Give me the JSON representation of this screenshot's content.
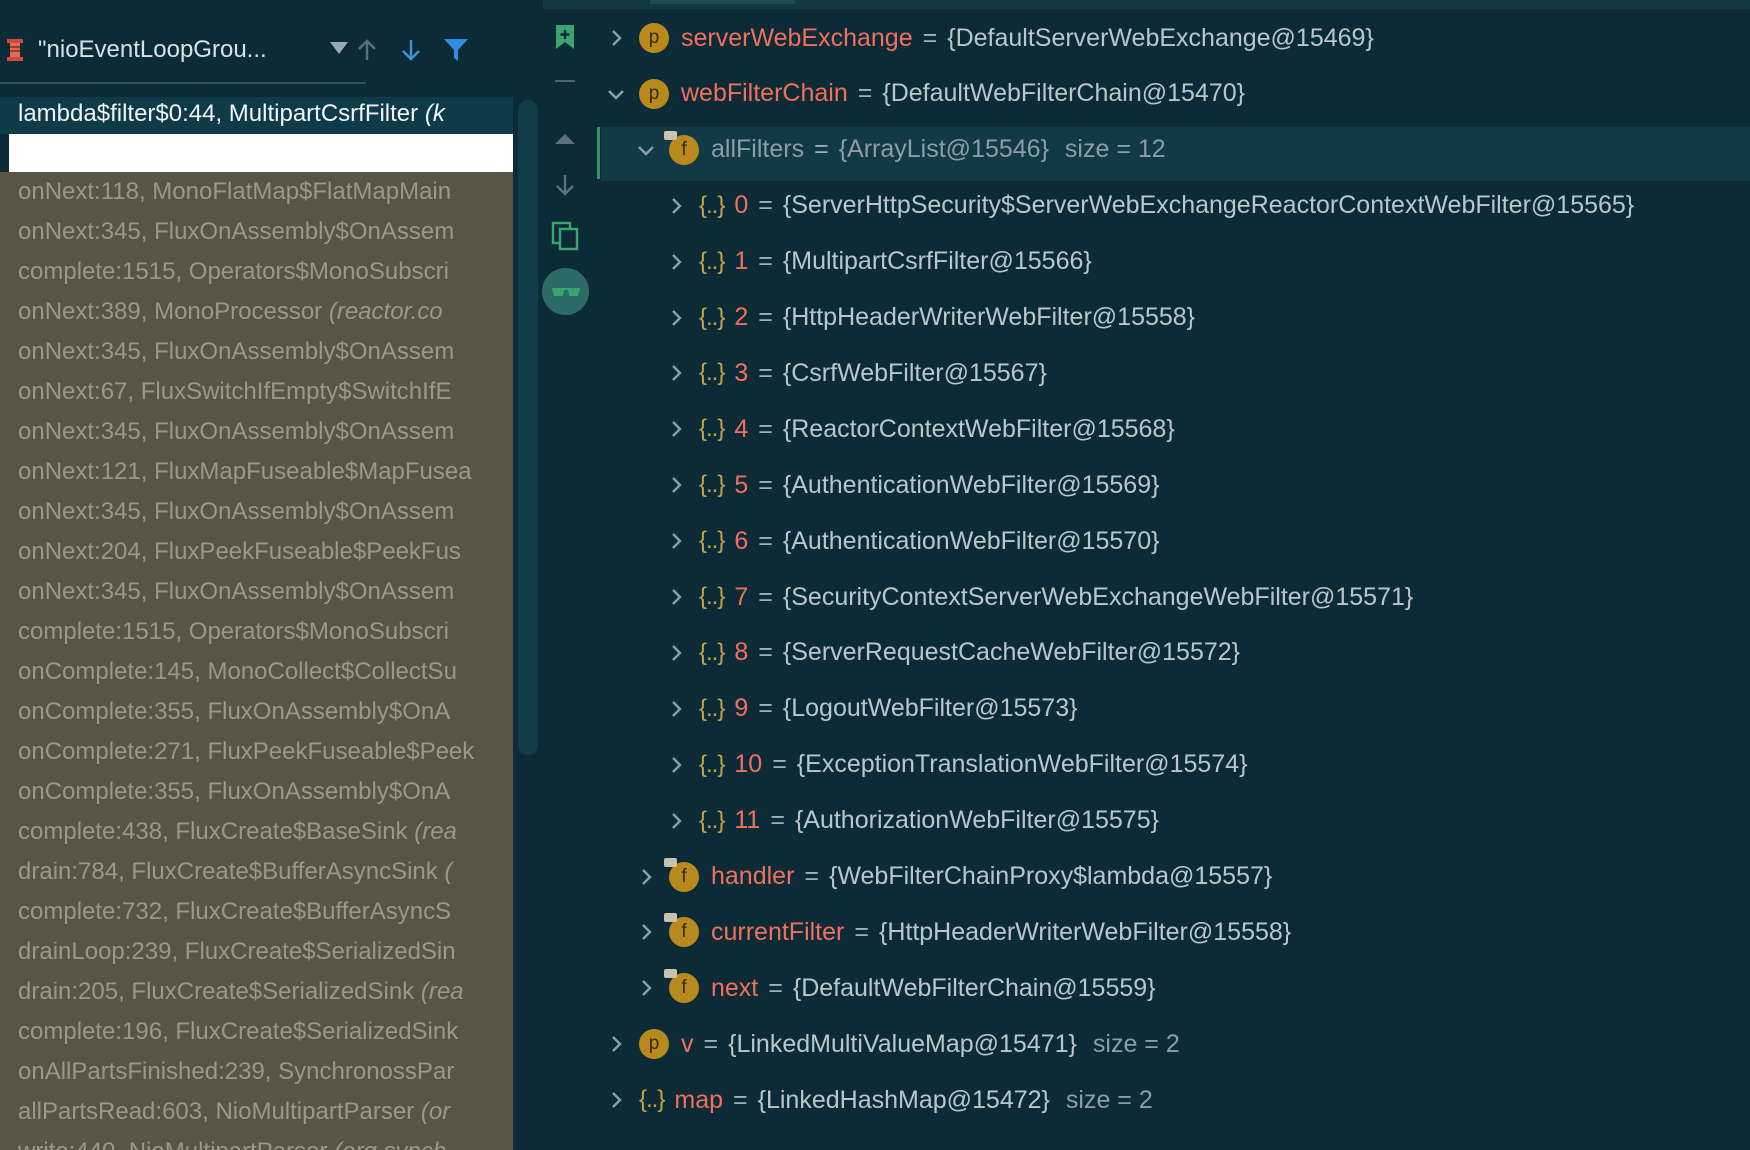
{
  "thread": {
    "name": "\"nioEventLoopGrou...",
    "icon": "thread-spool-icon",
    "buttons": [
      "arrow-up-icon",
      "arrow-down-icon",
      "filter-icon"
    ]
  },
  "selected_frame": {
    "name": "lambda$filter$0:44, MultipartCsrfFilter",
    "suffix": "(k"
  },
  "frames": [
    {
      "name": "onNext:118, MonoFlatMap$FlatMapMain",
      "suffix": ""
    },
    {
      "name": "onNext:345, FluxOnAssembly$OnAssem",
      "suffix": ""
    },
    {
      "name": "complete:1515, Operators$MonoSubscri",
      "suffix": ""
    },
    {
      "name": "onNext:389, MonoProcessor",
      "suffix": "(reactor.co"
    },
    {
      "name": "onNext:345, FluxOnAssembly$OnAssem",
      "suffix": ""
    },
    {
      "name": "onNext:67, FluxSwitchIfEmpty$SwitchIfE",
      "suffix": ""
    },
    {
      "name": "onNext:345, FluxOnAssembly$OnAssem",
      "suffix": ""
    },
    {
      "name": "onNext:121, FluxMapFuseable$MapFusea",
      "suffix": ""
    },
    {
      "name": "onNext:345, FluxOnAssembly$OnAssem",
      "suffix": ""
    },
    {
      "name": "onNext:204, FluxPeekFuseable$PeekFus",
      "suffix": ""
    },
    {
      "name": "onNext:345, FluxOnAssembly$OnAssem",
      "suffix": ""
    },
    {
      "name": "complete:1515, Operators$MonoSubscri",
      "suffix": ""
    },
    {
      "name": "onComplete:145, MonoCollect$CollectSu",
      "suffix": ""
    },
    {
      "name": "onComplete:355, FluxOnAssembly$OnA",
      "suffix": ""
    },
    {
      "name": "onComplete:271, FluxPeekFuseable$Peek",
      "suffix": ""
    },
    {
      "name": "onComplete:355, FluxOnAssembly$OnA",
      "suffix": ""
    },
    {
      "name": "complete:438, FluxCreate$BaseSink",
      "suffix": "(rea"
    },
    {
      "name": "drain:784, FluxCreate$BufferAsyncSink",
      "suffix": "("
    },
    {
      "name": "complete:732, FluxCreate$BufferAsyncS",
      "suffix": ""
    },
    {
      "name": "drainLoop:239, FluxCreate$SerializedSin",
      "suffix": ""
    },
    {
      "name": "drain:205, FluxCreate$SerializedSink",
      "suffix": "(rea"
    },
    {
      "name": "complete:196, FluxCreate$SerializedSink",
      "suffix": ""
    },
    {
      "name": "onAllPartsFinished:239, SynchronossPar",
      "suffix": ""
    },
    {
      "name": "allPartsRead:603, NioMultipartParser",
      "suffix": "(or"
    },
    {
      "name": "write:440, NioMultipartParser",
      "suffix": "(org.synch"
    }
  ],
  "gutter_icons": [
    "bookmark-plus-icon",
    "collapse-minus-icon",
    "triangle-up-icon",
    "arrow-down-icon",
    "copy-icon",
    "glasses-icon"
  ],
  "variables": [
    {
      "depth": 0,
      "expand": "collapsed",
      "badge": "p",
      "name": "serverWebExchange",
      "value": "{DefaultServerWebExchange@15469}",
      "size": ""
    },
    {
      "depth": 0,
      "expand": "expanded",
      "badge": "p",
      "name": "webFilterChain",
      "value": "{DefaultWebFilterChain@15470}",
      "size": ""
    },
    {
      "depth": 1,
      "expand": "expanded",
      "badge": "f",
      "name": "allFilters",
      "value": "{ArrayList@15546}",
      "size": "size = 12",
      "dim": true
    },
    {
      "depth": 2,
      "expand": "collapsed",
      "badge": "arr",
      "name": "0",
      "value": "{ServerHttpSecurity$ServerWebExchangeReactorContextWebFilter@15565}",
      "size": ""
    },
    {
      "depth": 2,
      "expand": "collapsed",
      "badge": "arr",
      "name": "1",
      "value": "{MultipartCsrfFilter@15566}",
      "size": ""
    },
    {
      "depth": 2,
      "expand": "collapsed",
      "badge": "arr",
      "name": "2",
      "value": "{HttpHeaderWriterWebFilter@15558}",
      "size": ""
    },
    {
      "depth": 2,
      "expand": "collapsed",
      "badge": "arr",
      "name": "3",
      "value": "{CsrfWebFilter@15567}",
      "size": ""
    },
    {
      "depth": 2,
      "expand": "collapsed",
      "badge": "arr",
      "name": "4",
      "value": "{ReactorContextWebFilter@15568}",
      "size": ""
    },
    {
      "depth": 2,
      "expand": "collapsed",
      "badge": "arr",
      "name": "5",
      "value": "{AuthenticationWebFilter@15569}",
      "size": ""
    },
    {
      "depth": 2,
      "expand": "collapsed",
      "badge": "arr",
      "name": "6",
      "value": "{AuthenticationWebFilter@15570}",
      "size": ""
    },
    {
      "depth": 2,
      "expand": "collapsed",
      "badge": "arr",
      "name": "7",
      "value": "{SecurityContextServerWebExchangeWebFilter@15571}",
      "size": ""
    },
    {
      "depth": 2,
      "expand": "collapsed",
      "badge": "arr",
      "name": "8",
      "value": "{ServerRequestCacheWebFilter@15572}",
      "size": ""
    },
    {
      "depth": 2,
      "expand": "collapsed",
      "badge": "arr",
      "name": "9",
      "value": "{LogoutWebFilter@15573}",
      "size": ""
    },
    {
      "depth": 2,
      "expand": "collapsed",
      "badge": "arr",
      "name": "10",
      "value": "{ExceptionTranslationWebFilter@15574}",
      "size": ""
    },
    {
      "depth": 2,
      "expand": "collapsed",
      "badge": "arr",
      "name": "11",
      "value": "{AuthorizationWebFilter@15575}",
      "size": ""
    },
    {
      "depth": 1,
      "expand": "collapsed",
      "badge": "f",
      "name": "handler",
      "value": "{WebFilterChainProxy$lambda@15557}",
      "size": ""
    },
    {
      "depth": 1,
      "expand": "collapsed",
      "badge": "f",
      "name": "currentFilter",
      "value": "{HttpHeaderWriterWebFilter@15558}",
      "size": ""
    },
    {
      "depth": 1,
      "expand": "collapsed",
      "badge": "f",
      "name": "next",
      "value": "{DefaultWebFilterChain@15559}",
      "size": ""
    },
    {
      "depth": 0,
      "expand": "collapsed",
      "badge": "p",
      "name": "v",
      "value": "{LinkedMultiValueMap@15471}",
      "size": "size = 2"
    },
    {
      "depth": 0,
      "expand": "collapsed",
      "badge": "arr",
      "name": "map",
      "value": "{LinkedHashMap@15472}",
      "size": "size = 2"
    }
  ],
  "colors": {
    "background": "#0d2b36",
    "frames_background": "#5a5446",
    "variable_name": "#f0705e",
    "value_text": "#b9c7cb",
    "badge": "#b88a1e",
    "accent_blue": "#2f8ee0"
  }
}
